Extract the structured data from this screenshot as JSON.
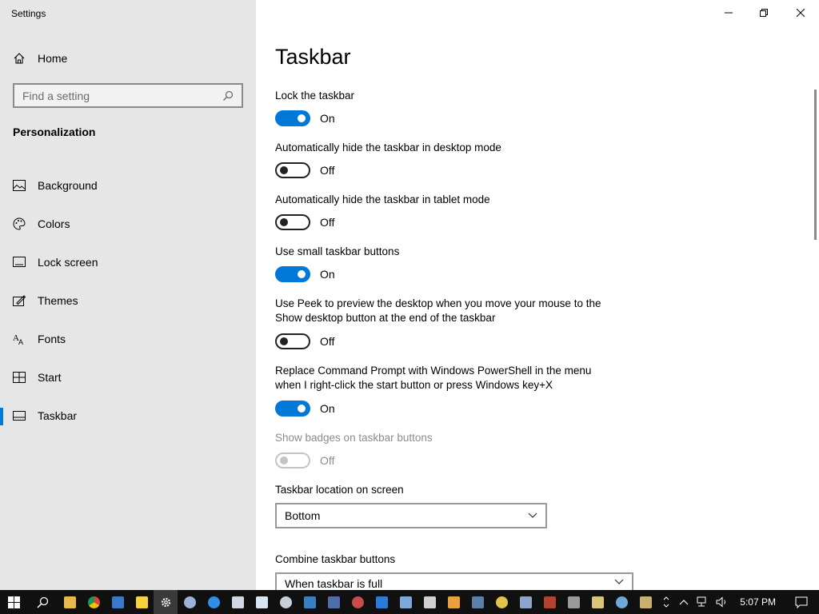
{
  "window": {
    "title": "Settings",
    "minimize_icon": "minimize-icon",
    "restore_icon": "restore-icon",
    "close_icon": "close-icon"
  },
  "sidebar": {
    "home_label": "Home",
    "search_placeholder": "Find a setting",
    "section_title": "Personalization",
    "items": [
      {
        "label": "Background",
        "icon": "picture-icon"
      },
      {
        "label": "Colors",
        "icon": "palette-icon"
      },
      {
        "label": "Lock screen",
        "icon": "lock-screen-icon"
      },
      {
        "label": "Themes",
        "icon": "themes-icon"
      },
      {
        "label": "Fonts",
        "icon": "fonts-icon"
      },
      {
        "label": "Start",
        "icon": "start-icon"
      },
      {
        "label": "Taskbar",
        "icon": "taskbar-icon",
        "active": true
      }
    ]
  },
  "main": {
    "title": "Taskbar",
    "settings": [
      {
        "label": "Lock the taskbar",
        "state": "On"
      },
      {
        "label": "Automatically hide the taskbar in desktop mode",
        "state": "Off"
      },
      {
        "label": "Automatically hide the taskbar in tablet mode",
        "state": "Off"
      },
      {
        "label": "Use small taskbar buttons",
        "state": "On"
      },
      {
        "label": "Use Peek to preview the desktop when you move your mouse to the Show desktop button at the end of the taskbar",
        "state": "Off"
      },
      {
        "label": "Replace Command Prompt with Windows PowerShell in the menu when I right-click the start button or press Windows key+X",
        "state": "On"
      },
      {
        "label": "Show badges on taskbar buttons",
        "state": "Off",
        "disabled": true
      }
    ],
    "location": {
      "label": "Taskbar location on screen",
      "value": "Bottom"
    },
    "combine": {
      "label": "Combine taskbar buttons",
      "value": "When taskbar is full"
    }
  },
  "taskbar": {
    "time": "5:07 PM"
  },
  "colors": {
    "accent": "#0078d7",
    "sidebar_bg": "#e6e6e6",
    "taskbar_bg": "#101010"
  }
}
